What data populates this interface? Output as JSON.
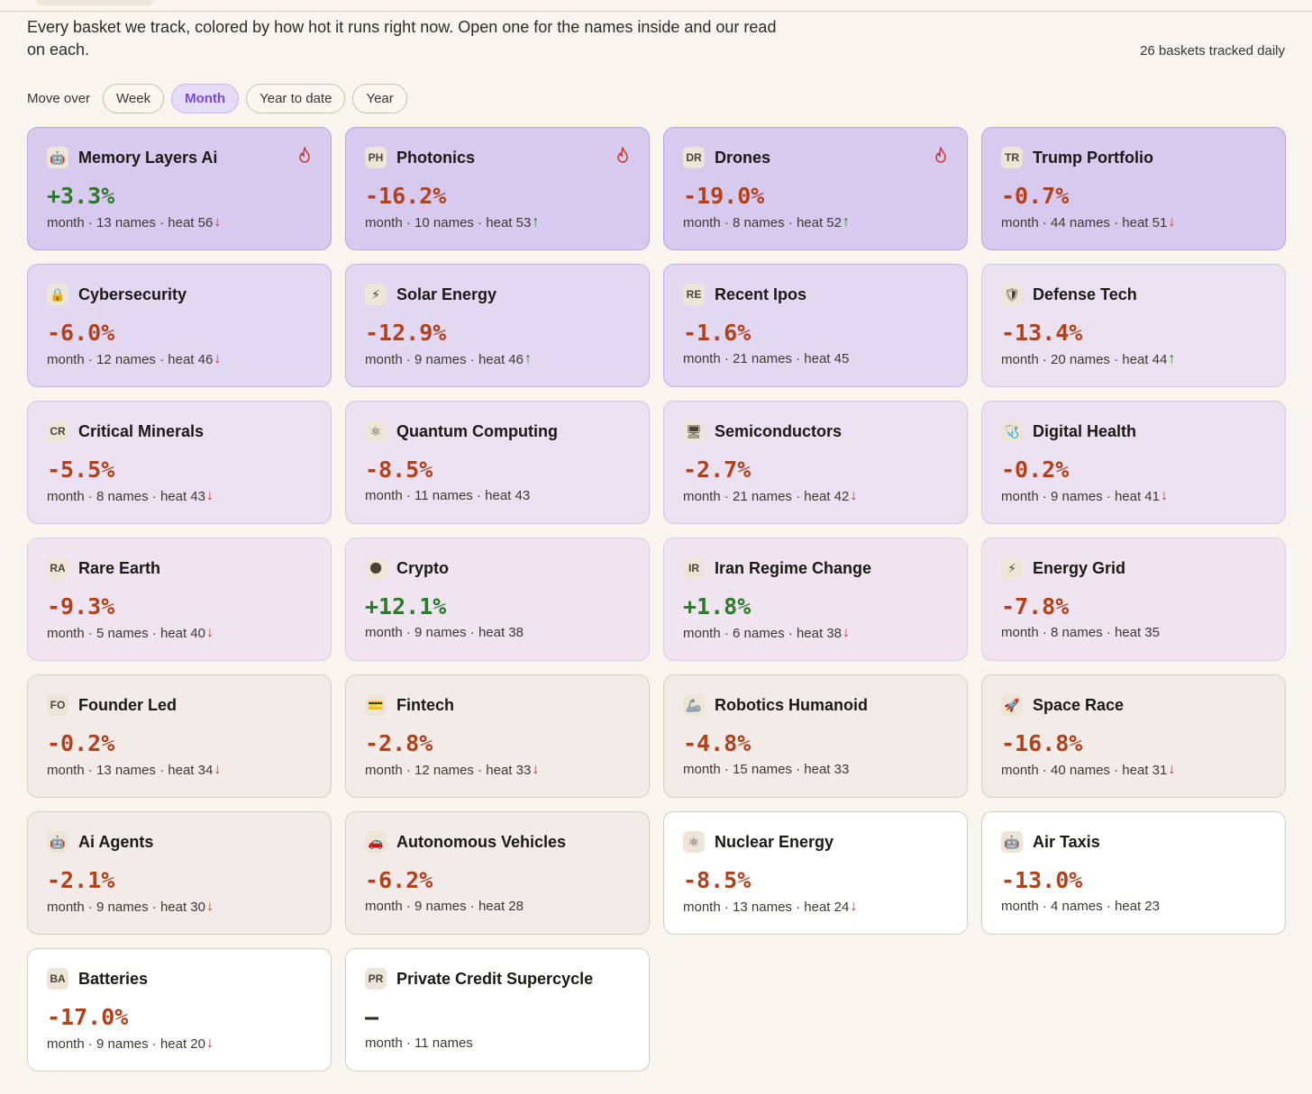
{
  "intro": "Every basket we track, colored by how hot it runs right now. Open one for the names inside and our read on each.",
  "tracked": "26 baskets tracked daily",
  "move_label": "Move over",
  "periods": [
    {
      "label": "Week",
      "active": false
    },
    {
      "label": "Month",
      "active": true
    },
    {
      "label": "Year to date",
      "active": false
    },
    {
      "label": "Year",
      "active": false
    }
  ],
  "baskets": [
    {
      "name": "Memory Layers Ai",
      "badge": "🤖",
      "badge_type": "emoji",
      "change": "+3.3%",
      "dir": "pos",
      "period": "month",
      "names": "13 names",
      "heat": "heat 56",
      "trend": "down",
      "hot": true,
      "tier": 1
    },
    {
      "name": "Photonics",
      "badge": "PH",
      "badge_type": "text",
      "change": "-16.2%",
      "dir": "neg",
      "period": "month",
      "names": "10 names",
      "heat": "heat 53",
      "trend": "up",
      "hot": true,
      "tier": 1
    },
    {
      "name": "Drones",
      "badge": "DR",
      "badge_type": "text",
      "change": "-19.0%",
      "dir": "neg",
      "period": "month",
      "names": "8 names",
      "heat": "heat 52",
      "trend": "up",
      "hot": true,
      "tier": 1
    },
    {
      "name": "Trump Portfolio",
      "badge": "TR",
      "badge_type": "text",
      "change": "-0.7%",
      "dir": "neg",
      "period": "month",
      "names": "44 names",
      "heat": "heat 51",
      "trend": "down",
      "hot": false,
      "tier": 1
    },
    {
      "name": "Cybersecurity",
      "badge": "🔒",
      "badge_type": "emoji",
      "change": "-6.0%",
      "dir": "neg",
      "period": "month",
      "names": "12 names",
      "heat": "heat 46",
      "trend": "down",
      "hot": false,
      "tier": 2
    },
    {
      "name": "Solar Energy",
      "badge": "⚡",
      "badge_type": "emoji",
      "change": "-12.9%",
      "dir": "neg",
      "period": "month",
      "names": "9 names",
      "heat": "heat 46",
      "trend": "up",
      "hot": false,
      "tier": 2
    },
    {
      "name": "Recent Ipos",
      "badge": "RE",
      "badge_type": "text",
      "change": "-1.6%",
      "dir": "neg",
      "period": "month",
      "names": "21 names",
      "heat": "heat 45",
      "trend": "",
      "hot": false,
      "tier": 2
    },
    {
      "name": "Defense Tech",
      "badge": "🛡",
      "badge_type": "emoji",
      "change": "-13.4%",
      "dir": "neg",
      "period": "month",
      "names": "20 names",
      "heat": "heat 44",
      "trend": "up",
      "hot": false,
      "tier": 3
    },
    {
      "name": "Critical Minerals",
      "badge": "CR",
      "badge_type": "text",
      "change": "-5.5%",
      "dir": "neg",
      "period": "month",
      "names": "8 names",
      "heat": "heat 43",
      "trend": "down",
      "hot": false,
      "tier": 3
    },
    {
      "name": "Quantum Computing",
      "badge": "⚛",
      "badge_type": "emoji",
      "change": "-8.5%",
      "dir": "neg",
      "period": "month",
      "names": "11 names",
      "heat": "heat 43",
      "trend": "",
      "hot": false,
      "tier": 3
    },
    {
      "name": "Semiconductors",
      "badge": "🖥",
      "badge_type": "emoji",
      "change": "-2.7%",
      "dir": "neg",
      "period": "month",
      "names": "21 names",
      "heat": "heat 42",
      "trend": "down",
      "hot": false,
      "tier": 3
    },
    {
      "name": "Digital Health",
      "badge": "🩺",
      "badge_type": "emoji",
      "change": "-0.2%",
      "dir": "neg",
      "period": "month",
      "names": "9 names",
      "heat": "heat 41",
      "trend": "down",
      "hot": false,
      "tier": 3
    },
    {
      "name": "Rare Earth",
      "badge": "RA",
      "badge_type": "text",
      "change": "-9.3%",
      "dir": "neg",
      "period": "month",
      "names": "5 names",
      "heat": "heat 40",
      "trend": "down",
      "hot": false,
      "tier": 4
    },
    {
      "name": "Crypto",
      "badge": "🌑",
      "badge_type": "emoji",
      "change": "+12.1%",
      "dir": "pos",
      "period": "month",
      "names": "9 names",
      "heat": "heat 38",
      "trend": "",
      "hot": false,
      "tier": 4
    },
    {
      "name": "Iran Regime Change",
      "badge": "IR",
      "badge_type": "text",
      "change": "+1.8%",
      "dir": "pos",
      "period": "month",
      "names": "6 names",
      "heat": "heat 38",
      "trend": "down",
      "hot": false,
      "tier": 4
    },
    {
      "name": "Energy Grid",
      "badge": "⚡",
      "badge_type": "emoji",
      "change": "-7.8%",
      "dir": "neg",
      "period": "month",
      "names": "8 names",
      "heat": "heat 35",
      "trend": "",
      "hot": false,
      "tier": 4
    },
    {
      "name": "Founder Led",
      "badge": "FO",
      "badge_type": "text",
      "change": "-0.2%",
      "dir": "neg",
      "period": "month",
      "names": "13 names",
      "heat": "heat 34",
      "trend": "down",
      "hot": false,
      "tier": 5
    },
    {
      "name": "Fintech",
      "badge": "💳",
      "badge_type": "emoji",
      "change": "-2.8%",
      "dir": "neg",
      "period": "month",
      "names": "12 names",
      "heat": "heat 33",
      "trend": "down",
      "hot": false,
      "tier": 5
    },
    {
      "name": "Robotics Humanoid",
      "badge": "🦾",
      "badge_type": "emoji",
      "change": "-4.8%",
      "dir": "neg",
      "period": "month",
      "names": "15 names",
      "heat": "heat 33",
      "trend": "",
      "hot": false,
      "tier": 5
    },
    {
      "name": "Space Race",
      "badge": "🚀",
      "badge_type": "emoji",
      "change": "-16.8%",
      "dir": "neg",
      "period": "month",
      "names": "40 names",
      "heat": "heat 31",
      "trend": "down",
      "hot": false,
      "tier": 5
    },
    {
      "name": "Ai Agents",
      "badge": "🤖",
      "badge_type": "emoji",
      "change": "-2.1%",
      "dir": "neg",
      "period": "month",
      "names": "9 names",
      "heat": "heat 30",
      "trend": "down",
      "hot": false,
      "tier": 5
    },
    {
      "name": "Autonomous Vehicles",
      "badge": "🚗",
      "badge_type": "emoji",
      "change": "-6.2%",
      "dir": "neg",
      "period": "month",
      "names": "9 names",
      "heat": "heat 28",
      "trend": "",
      "hot": false,
      "tier": 5
    },
    {
      "name": "Nuclear Energy",
      "badge": "⚛",
      "badge_type": "emoji",
      "change": "-8.5%",
      "dir": "neg",
      "period": "month",
      "names": "13 names",
      "heat": "heat 24",
      "trend": "down",
      "hot": false,
      "tier": 6
    },
    {
      "name": "Air Taxis",
      "badge": "🤖",
      "badge_type": "emoji",
      "change": "-13.0%",
      "dir": "neg",
      "period": "month",
      "names": "4 names",
      "heat": "heat 23",
      "trend": "",
      "hot": false,
      "tier": 6
    },
    {
      "name": "Batteries",
      "badge": "BA",
      "badge_type": "text",
      "change": "-17.0%",
      "dir": "neg",
      "period": "month",
      "names": "9 names",
      "heat": "heat 20",
      "trend": "down",
      "hot": false,
      "tier": 6
    },
    {
      "name": "Private Credit Supercycle",
      "badge": "PR",
      "badge_type": "text",
      "change": "—",
      "dir": "none",
      "period": "month",
      "names": "11 names",
      "heat": "",
      "trend": "",
      "hot": false,
      "tier": 6
    }
  ],
  "colors": {
    "negative": "#b2401a",
    "positive": "#2a7a2a",
    "accent": "#7a48d6",
    "flame": "#c0392b"
  }
}
